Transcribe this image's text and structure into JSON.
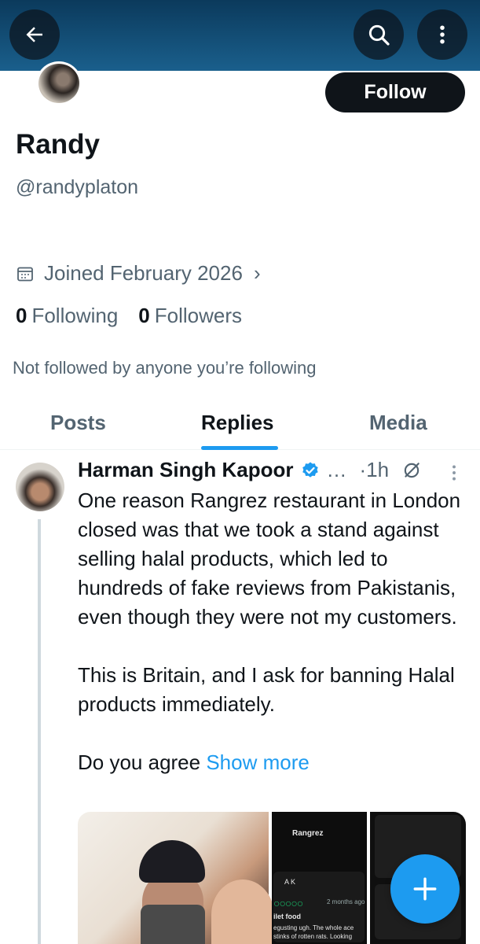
{
  "profile": {
    "name": "Randy",
    "handle": "@randyplaton",
    "follow_label": "Follow",
    "joined": "Joined February 2026",
    "following_count": "0",
    "following_label": "Following",
    "followers_count": "0",
    "followers_label": "Followers",
    "not_followed": "Not followed by anyone you’re following"
  },
  "tabs": [
    {
      "label": "Posts",
      "active": false
    },
    {
      "label": "Replies",
      "active": true
    },
    {
      "label": "Media",
      "active": false
    }
  ],
  "post": {
    "author": "Harman Singh Kapoor",
    "ellipsis": "…",
    "time": "·1h",
    "text": "One reason Rangrez restaurant in London closed was that we took a stand against selling halal products, which led to hundreds of fake reviews from Pakistanis, even though they were not my customers.\n\nThis is Britain, and I ask for banning Halal products immediately.\n\nDo you agree",
    "show_more": "Show more",
    "media_texts": {
      "header": "Rangrez",
      "reviewer": "A K",
      "age": "2 months ago",
      "title": "ilet food",
      "body": "egusting ugh. The whole ace stinks of rotten rats. Looking"
    }
  },
  "colors": {
    "accent": "#1d9bf0",
    "text_primary": "#0f1419",
    "text_secondary": "#536471",
    "header_bg": "#0b3a5c"
  },
  "icons": {
    "back": "arrow-left-icon",
    "search": "search-icon",
    "more": "more-vertical-icon",
    "calendar": "calendar-icon",
    "verified": "verified-badge-icon",
    "grok": "grok-icon",
    "compose": "plus-icon"
  }
}
